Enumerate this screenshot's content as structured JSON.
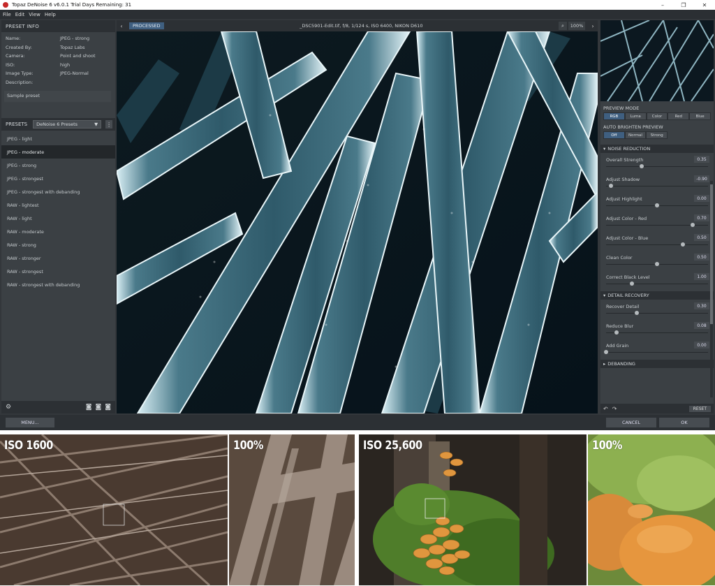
{
  "window": {
    "title": "Topaz DeNoise 6 v6.0.1   Trial Days Remaining: 31",
    "controls": [
      "–",
      "❐",
      "✕"
    ]
  },
  "menu": [
    "File",
    "Edit",
    "View",
    "Help"
  ],
  "preset_info": {
    "heading": "PRESET INFO",
    "rows": [
      {
        "k": "Name:",
        "v": "JPEG - strong"
      },
      {
        "k": "Created By:",
        "v": "Topaz Labs"
      },
      {
        "k": "Camera:",
        "v": "Point and shoot"
      },
      {
        "k": "ISO:",
        "v": "high"
      },
      {
        "k": "Image Type:",
        "v": "JPEG-Normal"
      },
      {
        "k": "Description:",
        "v": ""
      }
    ],
    "description": "Sample preset"
  },
  "presets": {
    "heading": "PRESETS",
    "selected_group": "DeNoise 6 Presets",
    "items": [
      "JPEG - light",
      "JPEG - moderate",
      "JPEG - strong",
      "JPEG - strongest",
      "JPEG - strongest with debanding",
      "RAW - lightest",
      "RAW - light",
      "RAW - moderate",
      "RAW - strong",
      "RAW - stronger",
      "RAW - strongest",
      "RAW - strongest with debanding"
    ],
    "selected_index": 1
  },
  "viewer": {
    "mode_badge": "PROCESSED",
    "file_info": "_DSC5901-Edit.tif, f/8, 1/124 s, ISO 6400, NIKON D610",
    "zoom": "100%"
  },
  "preview_mode": {
    "label": "PREVIEW MODE",
    "options": [
      "RGB",
      "Luma",
      "Color",
      "Red",
      "Blue"
    ],
    "selected": 0
  },
  "auto_brighten": {
    "label": "AUTO BRIGHTEN PREVIEW",
    "options": [
      "Off",
      "Normal",
      "Strong"
    ],
    "selected": 0
  },
  "noise_reduction": {
    "heading": "NOISE REDUCTION",
    "sliders": [
      {
        "label": "Overall Strength",
        "value": "0.35",
        "pos": 0.35
      },
      {
        "label": "Adjust Shadow",
        "value": "-0.90",
        "pos": 0.05
      },
      {
        "label": "Adjust Highlight",
        "value": "0.00",
        "pos": 0.5
      },
      {
        "label": "Adjust Color - Red",
        "value": "0.70",
        "pos": 0.85
      },
      {
        "label": "Adjust Color - Blue",
        "value": "0.50",
        "pos": 0.75
      },
      {
        "label": "Clean Color",
        "value": "0.50",
        "pos": 0.5
      },
      {
        "label": "Correct Black Level",
        "value": "1.00",
        "pos": 0.25
      }
    ]
  },
  "detail_recovery": {
    "heading": "DETAIL RECOVERY",
    "sliders": [
      {
        "label": "Recover Detail",
        "value": "0.30",
        "pos": 0.3
      },
      {
        "label": "Reduce Blur",
        "value": "0.08",
        "pos": 0.1
      },
      {
        "label": "Add Grain",
        "value": "0.00",
        "pos": 0.0
      }
    ]
  },
  "debanding": {
    "heading": "DEBANDING"
  },
  "footer": {
    "reset": "RESET",
    "menu": "MENU...",
    "cancel": "CANCEL",
    "ok": "OK"
  },
  "samples": [
    {
      "caption": "ISO 1600"
    },
    {
      "caption": "100%"
    },
    {
      "caption": "ISO 25,600"
    },
    {
      "caption": "100%"
    }
  ]
}
